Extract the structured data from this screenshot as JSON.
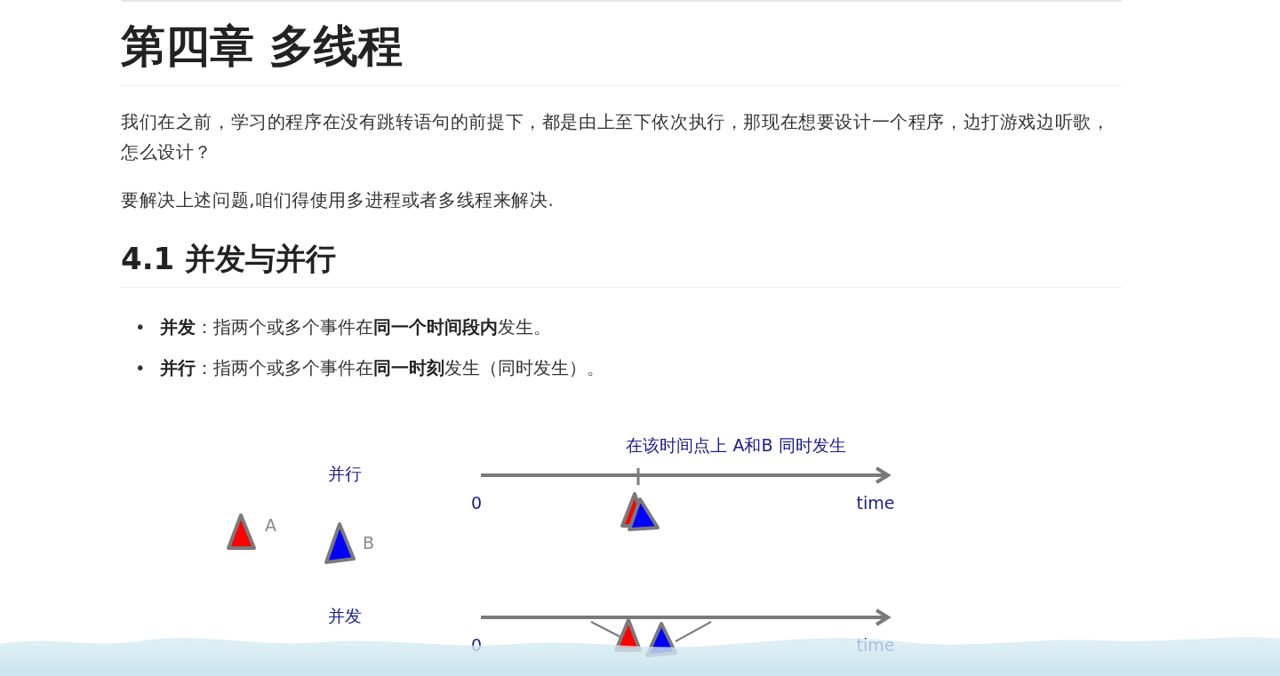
{
  "chapter_title": "第四章 多线程",
  "paragraphs": [
    "我们在之前，学习的程序在没有跳转语句的前提下，都是由上至下依次执行，那现在想要设计一个程序，边打游戏边听歌，怎么设计？",
    "要解决上述问题,咱们得使用多进程或者多线程来解决."
  ],
  "section_title": "4.1 并发与并行",
  "bullets": [
    {
      "marker": "•",
      "text": "**并发**：指两个或多个事件在**同一个时间段内**发生。"
    },
    {
      "marker": "•",
      "text": "**并行**：指两个或多个事件在**同一时刻**发生（同时发生）。"
    }
  ],
  "diagram": {
    "legend": [
      {
        "label": "A",
        "color": "#ff0000"
      },
      {
        "label": "B",
        "color": "#0000ff"
      }
    ],
    "timelines": [
      {
        "kind": "parallel",
        "label": "并行",
        "origin": "0",
        "end_label": "time",
        "caption": "在该时间点上 A和B 同时发生"
      },
      {
        "kind": "concurrent",
        "label": "并发",
        "origin": "0",
        "end_label": "time"
      }
    ]
  }
}
